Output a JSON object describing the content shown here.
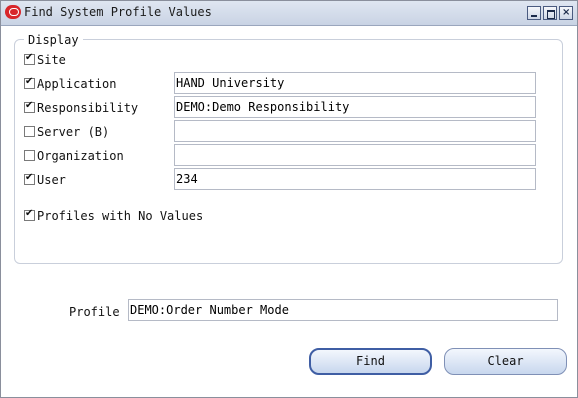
{
  "window": {
    "title": "Find System Profile Values"
  },
  "display_group": {
    "legend": "Display",
    "items": [
      {
        "label": "Site",
        "checked": true,
        "value": null
      },
      {
        "label": "Application",
        "checked": true,
        "value": "HAND University"
      },
      {
        "label": "Responsibility",
        "checked": true,
        "value": "DEMO:Demo Responsibility"
      },
      {
        "label": "Server (B)",
        "checked": false,
        "value": ""
      },
      {
        "label": "Organization",
        "checked": false,
        "value": ""
      },
      {
        "label": "User",
        "checked": true,
        "value": "234"
      }
    ],
    "no_values": {
      "label": "Profiles with No Values",
      "checked": true
    }
  },
  "profile": {
    "label": "Profile",
    "value": "DEMO:Order Number Mode"
  },
  "buttons": {
    "find": "Find",
    "clear": "Clear"
  },
  "colors": {
    "titlebar": "#c9d3e4",
    "button": "#c8d7ee",
    "focus_border": "#3f5ea4"
  }
}
